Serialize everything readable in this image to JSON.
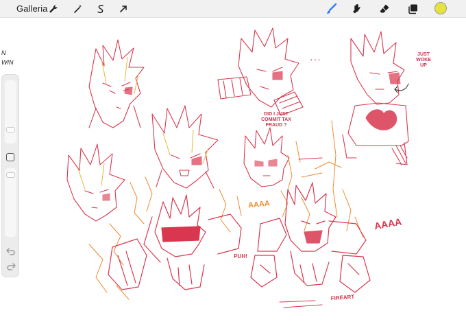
{
  "topbar": {
    "gallery_label": "Galleria",
    "left_tools": [
      {
        "name": "actions",
        "icon": "wrench-icon"
      },
      {
        "name": "adjustments",
        "icon": "magic-wand-icon"
      },
      {
        "name": "selection",
        "icon": "selection-s-icon"
      },
      {
        "name": "transform",
        "icon": "arrow-cursor-icon"
      }
    ],
    "right_tools": [
      {
        "name": "brush",
        "icon": "brush-icon",
        "active": true
      },
      {
        "name": "smudge",
        "icon": "smudge-icon"
      },
      {
        "name": "eraser",
        "icon": "eraser-icon"
      },
      {
        "name": "layers",
        "icon": "layers-icon"
      }
    ],
    "current_color": "#e8e23c",
    "accent_color": "#2d7cf6"
  },
  "sidebar": {
    "brush_size_icon": "brush-size-slider",
    "opacity_icon": "opacity-slider",
    "modify_icon": "modify-square-icon",
    "undo_icon": "undo-arrow-icon",
    "redo_icon": "redo-arrow-icon"
  },
  "canvas": {
    "side_text_top": "N",
    "side_text_bottom": "WIN",
    "annotations": {
      "just_woke_up": "JUST\nWOKE\nUP",
      "tax_fraud": "DID I JUST\nCOMMIT TAX\nFRAUD ?",
      "ellipsis": ". . .",
      "scream_1": "AAAA",
      "scream_2": "AAAA",
      "puh": "PUH!",
      "signature": "FIREART"
    },
    "ink_colors": {
      "red": "#d9374f",
      "orange": "#f08a2c",
      "gold": "#e8b63a"
    }
  }
}
